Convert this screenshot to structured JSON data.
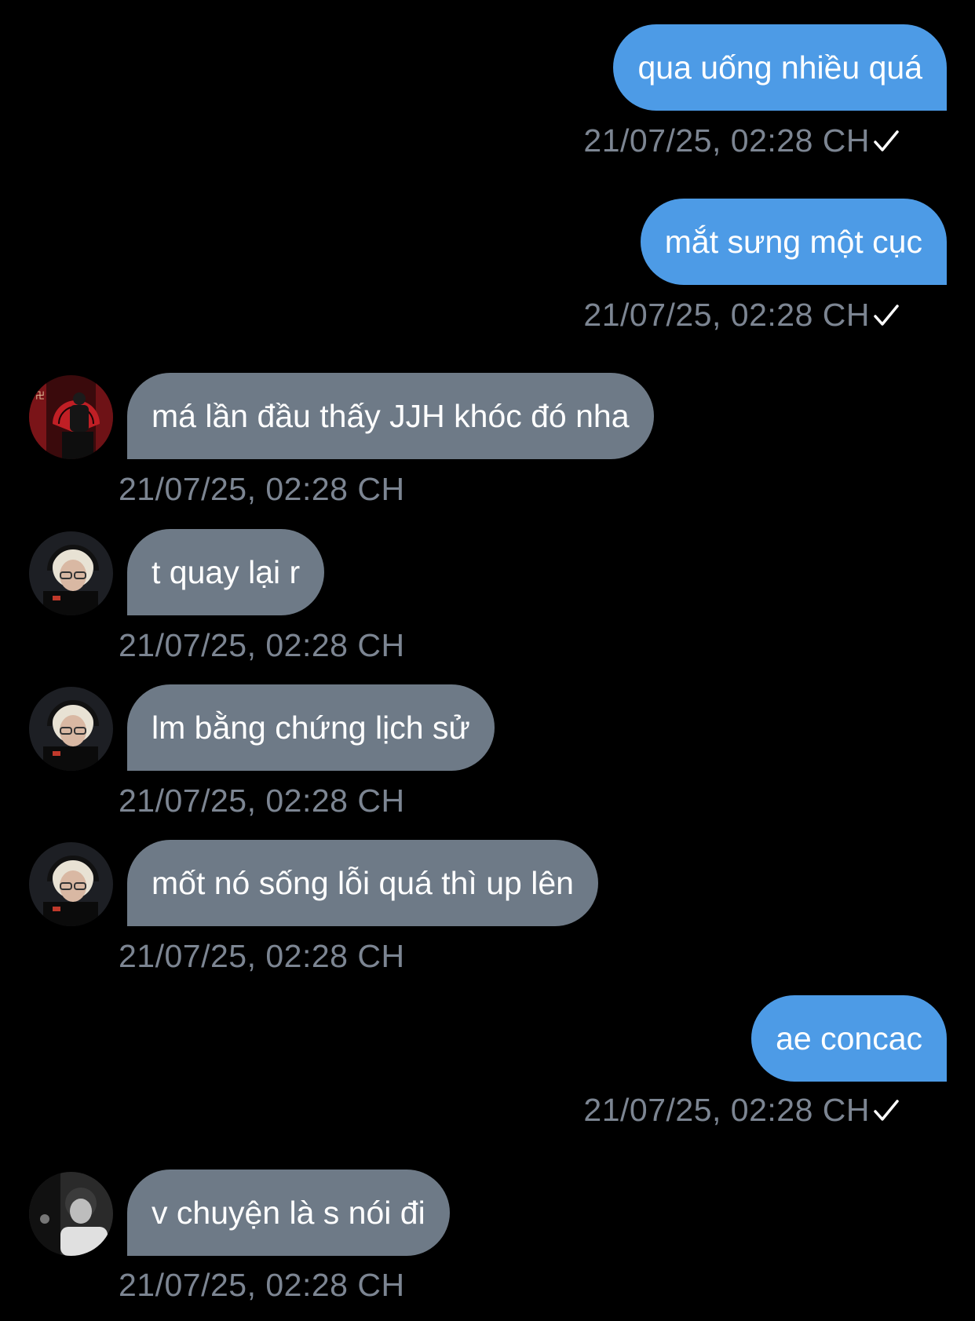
{
  "colors": {
    "background": "#000000",
    "outgoing_bubble": "#4d9be6",
    "incoming_bubble": "#6e7a87",
    "timestamp": "#7c8592"
  },
  "messages": [
    {
      "direction": "out",
      "text": "qua uống nhiều quá",
      "time": "21/07/25, 02:28 CH",
      "status_icon": "check-icon"
    },
    {
      "direction": "out",
      "text": "mắt sưng một cục",
      "time": "21/07/25, 02:28 CH",
      "status_icon": "check-icon"
    },
    {
      "direction": "in",
      "avatar": "red-fan-avatar",
      "text": "má lần đầu thấy JJH khóc đó nha",
      "time": "21/07/25, 02:28 CH"
    },
    {
      "direction": "in",
      "avatar": "blonde-headset-avatar",
      "text": "t quay lại r",
      "time": "21/07/25, 02:28 CH"
    },
    {
      "direction": "in",
      "avatar": "blonde-headset-avatar",
      "text": "lm bằng chứng lịch sử",
      "time": "21/07/25, 02:28 CH"
    },
    {
      "direction": "in",
      "avatar": "blonde-headset-avatar",
      "text": "mốt nó sống lỗi quá thì up lên",
      "time": "21/07/25, 02:28 CH"
    },
    {
      "direction": "out",
      "text": "ae concac",
      "time": "21/07/25, 02:28 CH",
      "status_icon": "check-icon"
    },
    {
      "direction": "in",
      "avatar": "monochrome-portrait-avatar",
      "text": "v chuyện là s nói đi",
      "time": "21/07/25, 02:28 CH"
    }
  ]
}
